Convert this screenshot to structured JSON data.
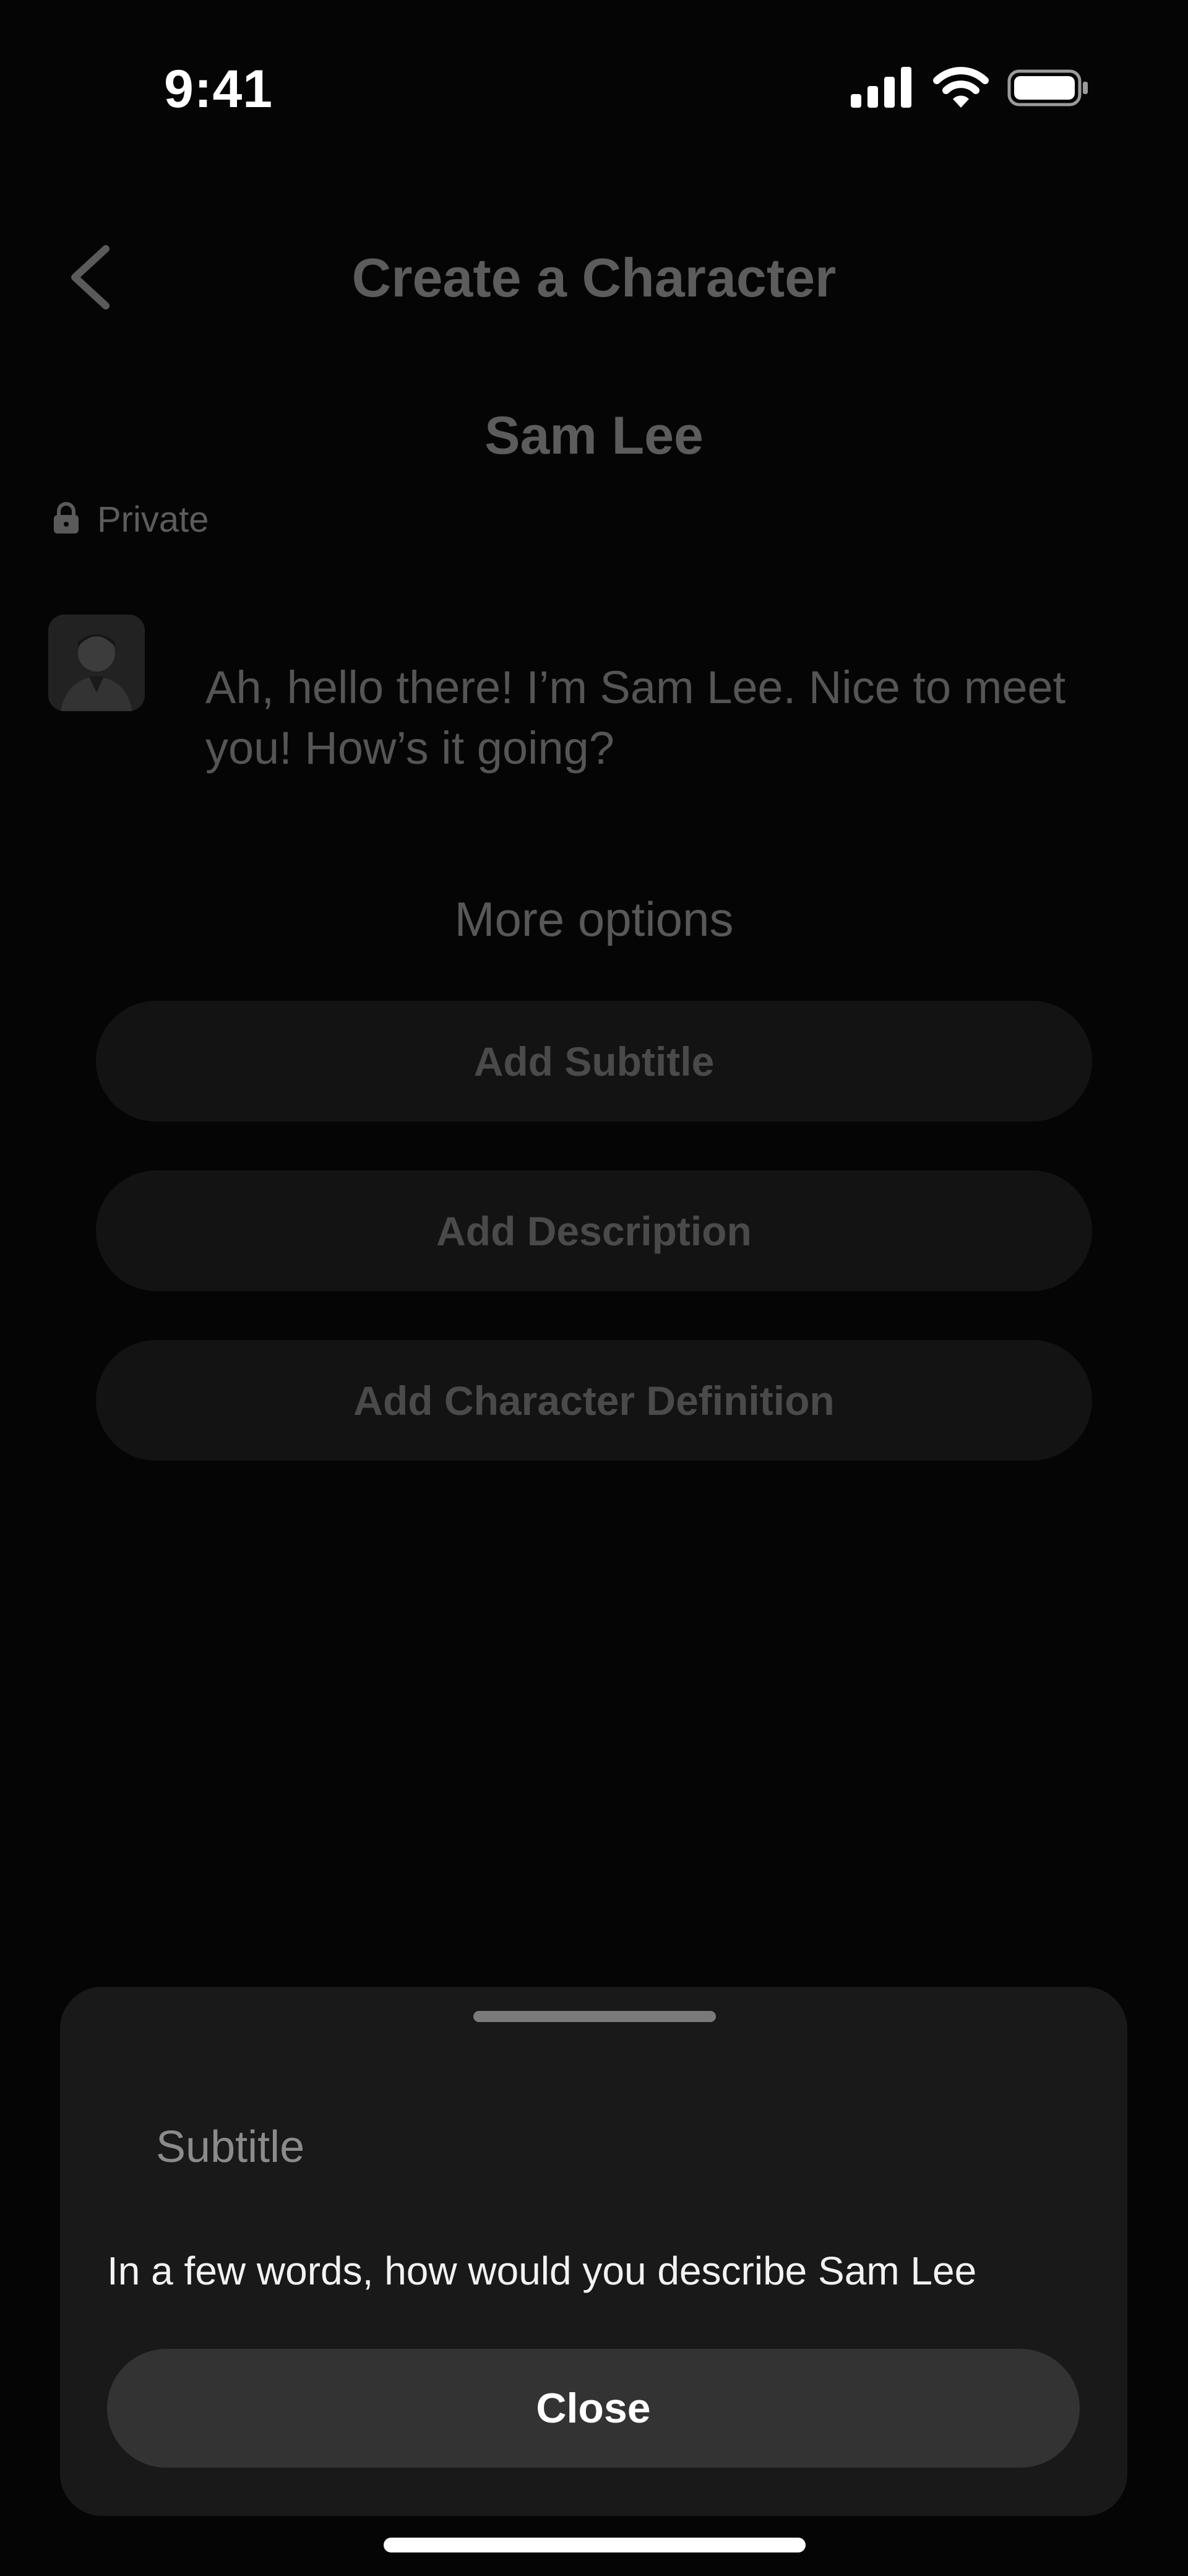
{
  "status_bar": {
    "time": "9:41"
  },
  "header": {
    "title": "Create a Character"
  },
  "character": {
    "name": "Sam Lee",
    "visibility": "Private",
    "greeting": "Ah, hello there! I’m Sam Lee. Nice to meet you! How’s it going?"
  },
  "more_options": {
    "heading": "More options",
    "buttons": [
      "Add Subtitle",
      "Add Description",
      "Add Character Definition"
    ]
  },
  "sheet": {
    "field_label": "Subtitle",
    "prompt": "In a few words, how would you describe Sam Lee",
    "close_label": "Close"
  },
  "colors": {
    "background": "#050505",
    "sheet": "#191919",
    "close_button": "#333333",
    "dimmed_text": "#5c5c5c"
  },
  "icons": [
    "signal-icon",
    "wifi-icon",
    "battery-icon",
    "back-chevron-icon",
    "lock-icon",
    "avatar"
  ]
}
